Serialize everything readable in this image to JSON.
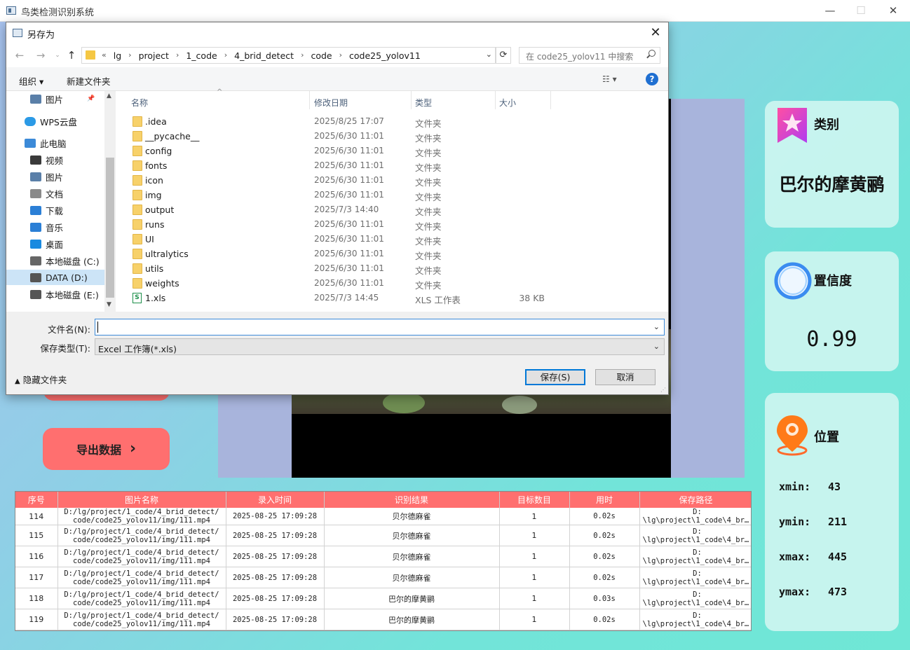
{
  "app": {
    "title": "鸟类检测识别系统",
    "export_button": "导出数据",
    "export_chevron": "›",
    "window_controls": {
      "minimize": "—",
      "maximize": "☐",
      "close": "✕"
    }
  },
  "cards": {
    "class": {
      "title": "类别",
      "value": "巴尔的摩黄鹂",
      "icon": "bookmark-star-icon"
    },
    "confidence": {
      "title": "置信度",
      "value": "0.99",
      "icon": "ring-icon"
    },
    "position": {
      "title": "位置",
      "icon": "location-pin-icon",
      "rows": [
        {
          "label": "xmin:",
          "value": "43"
        },
        {
          "label": "ymin:",
          "value": "211"
        },
        {
          "label": "xmax:",
          "value": "445"
        },
        {
          "label": "ymax:",
          "value": "473"
        }
      ]
    }
  },
  "table": {
    "headers": [
      "序号",
      "图片名称",
      "录入时间",
      "识别结果",
      "目标数目",
      "用时",
      "保存路径"
    ],
    "rows": [
      {
        "id": "114",
        "name1": "D:/lg/project/1_code/4_brid_detect/",
        "name2": "code/code25_yolov11/img/111.mp4",
        "time": "2025-08-25 17:09:28",
        "result": "贝尔德麻雀",
        "count": "1",
        "cost": "0.02s",
        "path1": "D:",
        "path2": "\\lg\\project\\1_code\\4_br…"
      },
      {
        "id": "115",
        "name1": "D:/lg/project/1_code/4_brid_detect/",
        "name2": "code/code25_yolov11/img/111.mp4",
        "time": "2025-08-25 17:09:28",
        "result": "贝尔德麻雀",
        "count": "1",
        "cost": "0.02s",
        "path1": "D:",
        "path2": "\\lg\\project\\1_code\\4_br…"
      },
      {
        "id": "116",
        "name1": "D:/lg/project/1_code/4_brid_detect/",
        "name2": "code/code25_yolov11/img/111.mp4",
        "time": "2025-08-25 17:09:28",
        "result": "贝尔德麻雀",
        "count": "1",
        "cost": "0.02s",
        "path1": "D:",
        "path2": "\\lg\\project\\1_code\\4_br…"
      },
      {
        "id": "117",
        "name1": "D:/lg/project/1_code/4_brid_detect/",
        "name2": "code/code25_yolov11/img/111.mp4",
        "time": "2025-08-25 17:09:28",
        "result": "贝尔德麻雀",
        "count": "1",
        "cost": "0.02s",
        "path1": "D:",
        "path2": "\\lg\\project\\1_code\\4_br…"
      },
      {
        "id": "118",
        "name1": "D:/lg/project/1_code/4_brid_detect/",
        "name2": "code/code25_yolov11/img/111.mp4",
        "time": "2025-08-25 17:09:28",
        "result": "巴尔的摩黄鹂",
        "count": "1",
        "cost": "0.03s",
        "path1": "D:",
        "path2": "\\lg\\project\\1_code\\4_br…"
      },
      {
        "id": "119",
        "name1": "D:/lg/project/1_code/4_brid_detect/",
        "name2": "code/code25_yolov11/img/111.mp4",
        "time": "2025-08-25 17:09:28",
        "result": "巴尔的摩黄鹂",
        "count": "1",
        "cost": "0.02s",
        "path1": "D:",
        "path2": "\\lg\\project\\1_code\\4_br…"
      }
    ]
  },
  "dialog": {
    "title": "另存为",
    "close": "✕",
    "address": {
      "prefix": "«",
      "segments": [
        "lg",
        "project",
        "1_code",
        "4_brid_detect",
        "code",
        "code25_yolov11"
      ]
    },
    "search_placeholder": "在 code25_yolov11 中搜索",
    "toolbar": {
      "organize": "组织 ▾",
      "new_folder": "新建文件夹",
      "view": "☷ ▾",
      "help": "?"
    },
    "nav_items": [
      {
        "label": "图片",
        "icon": "pictures-icon",
        "pinned": true
      },
      {
        "label": "WPS云盘",
        "icon": "cloud-icon"
      },
      {
        "label": "此电脑",
        "icon": "computer-icon"
      },
      {
        "label": "视频",
        "icon": "video-icon"
      },
      {
        "label": "图片",
        "icon": "pictures-icon"
      },
      {
        "label": "文档",
        "icon": "document-icon"
      },
      {
        "label": "下载",
        "icon": "download-icon"
      },
      {
        "label": "音乐",
        "icon": "music-icon"
      },
      {
        "label": "桌面",
        "icon": "desktop-icon"
      },
      {
        "label": "本地磁盘 (C:)",
        "icon": "drive-c-icon"
      },
      {
        "label": "DATA (D:)",
        "icon": "drive-icon",
        "selected": true
      },
      {
        "label": "本地磁盘 (E:)",
        "icon": "drive-icon"
      }
    ],
    "columns": {
      "name": "名称",
      "date": "修改日期",
      "type": "类型",
      "size": "大小"
    },
    "files": [
      {
        "name": ".idea",
        "date": "2025/8/25 17:07",
        "type": "文件夹",
        "size": ""
      },
      {
        "name": "__pycache__",
        "date": "2025/6/30 11:01",
        "type": "文件夹",
        "size": ""
      },
      {
        "name": "config",
        "date": "2025/6/30 11:01",
        "type": "文件夹",
        "size": ""
      },
      {
        "name": "fonts",
        "date": "2025/6/30 11:01",
        "type": "文件夹",
        "size": ""
      },
      {
        "name": "icon",
        "date": "2025/6/30 11:01",
        "type": "文件夹",
        "size": ""
      },
      {
        "name": "img",
        "date": "2025/6/30 11:01",
        "type": "文件夹",
        "size": ""
      },
      {
        "name": "output",
        "date": "2025/7/3 14:40",
        "type": "文件夹",
        "size": ""
      },
      {
        "name": "runs",
        "date": "2025/6/30 11:01",
        "type": "文件夹",
        "size": ""
      },
      {
        "name": "UI",
        "date": "2025/6/30 11:01",
        "type": "文件夹",
        "size": ""
      },
      {
        "name": "ultralytics",
        "date": "2025/6/30 11:01",
        "type": "文件夹",
        "size": ""
      },
      {
        "name": "utils",
        "date": "2025/6/30 11:01",
        "type": "文件夹",
        "size": ""
      },
      {
        "name": "weights",
        "date": "2025/6/30 11:01",
        "type": "文件夹",
        "size": ""
      },
      {
        "name": "1.xls",
        "date": "2025/7/3 14:45",
        "type": "XLS 工作表",
        "size": "38 KB",
        "kind": "xls"
      }
    ],
    "filename_label": "文件名(N):",
    "filename_value": "",
    "filetype_label": "保存类型(T):",
    "filetype_value": "Excel 工作簿(*.xls)",
    "hide_folders": "隐藏文件夹",
    "save": "保存(S)",
    "cancel": "取消"
  },
  "colors": {
    "accent_pink": "#ff6f6f",
    "card_bg": "#cdf5f0",
    "dialog_focus": "#0078d7"
  }
}
